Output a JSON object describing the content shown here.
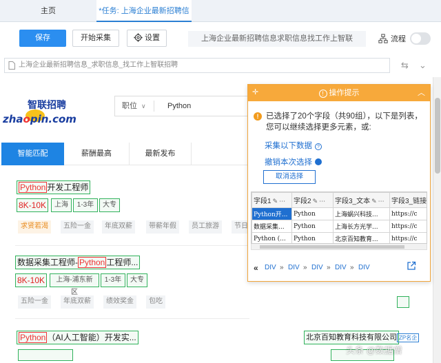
{
  "tabs": {
    "home": "主页",
    "task": "*任务: 上海企业最新招聘信息..."
  },
  "toolbar": {
    "save_label": "保存",
    "start_label": "开始采集",
    "settings_label": "设置",
    "page_title": "上海企业最新招聘信息求职信息找工作上智联",
    "flow_label": "流程"
  },
  "address": {
    "text": "上海企业最新招聘信息_求职信息_找工作上智联招聘"
  },
  "site": {
    "logo_cn": "智联招聘",
    "logo_en_a": "zha",
    "logo_en_o": "o",
    "logo_en_b": "pin.com",
    "search_category": "职位",
    "search_value": "Python"
  },
  "nav": {
    "tab1": "智能匹配",
    "tab2": "薪酬最高",
    "tab3": "最新发布"
  },
  "jobs": [
    {
      "kw": "Python",
      "title_rest": "开发工程师",
      "salary": "8K-10K",
      "location": "上海",
      "exp": "1-3年",
      "edu": "大专",
      "perks": [
        "求贤若渴",
        "五险一金",
        "年底双薪",
        "带薪年假",
        "员工旅游",
        "节日"
      ]
    },
    {
      "title_pre": "数据采集工程师-",
      "kw": "Python",
      "title_rest": "工程师...",
      "salary": "8K-10K",
      "location": "上海-浦东新区",
      "exp": "1-3年",
      "edu": "大专",
      "perks": [
        "五险一金",
        "年底双薪",
        "绩效奖金",
        "包吃"
      ]
    },
    {
      "kw": "Python",
      "title_rest": "（AI人工智能）开发实...",
      "company": "北京百知教育科技有限公司",
      "badge": "ZP名企"
    }
  ],
  "tips": {
    "title": "操作提示",
    "message": "已选择了20个字段（共90组），以下是列表，您可以继续选择更多元素，或:",
    "link_more": "采集以下数据",
    "link_undo": "撤销本次选择",
    "cancel": "取消选择",
    "columns": [
      "字段1",
      "字段2",
      "字段3_文本",
      "字段3_链接"
    ],
    "rows": [
      [
        "Python开...",
        "Python",
        "上海蜗兴科技...",
        "https://c"
      ],
      [
        "数据采集...",
        "Python",
        "上海长方光学...",
        "https://c"
      ],
      [
        "Python (...",
        "Python",
        "北京百知教育...",
        "https://c"
      ]
    ],
    "crumbs": [
      "«",
      "DIV",
      "»",
      "DIV",
      "»",
      "DIV",
      "»",
      "DIV",
      "»",
      "DIV"
    ]
  },
  "watermark": "头条 @数据僧"
}
